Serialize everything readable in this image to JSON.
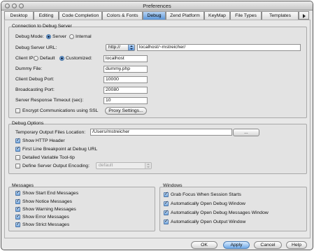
{
  "window": {
    "title": "Preferences"
  },
  "tabs": [
    "Desktop",
    "Editing",
    "Code Completion",
    "Colors & Fonts",
    "Debug",
    "Zend Platform",
    "KeyMap",
    "File Types",
    "Templates"
  ],
  "active_tab": "Debug",
  "connection": {
    "title": "Connection to Debug Server",
    "debug_mode_label": "Debug Mode:",
    "mode_server": "Server",
    "mode_internal": "Internal",
    "server_url_label": "Debug Server URL:",
    "protocol": "http://",
    "server_url": "localhost/~mstreicher/",
    "client_ip_label": "Client IP:",
    "ip_default": "Default",
    "ip_customized": "Customized:",
    "client_ip_value": "localhost",
    "dummy_file_label": "Dummy File:",
    "dummy_file_value": "dummy.php",
    "client_port_label": "Client Debug Port:",
    "client_port_value": "10000",
    "broadcast_port_label": "Broadcasting Port:",
    "broadcast_port_value": "20080",
    "timeout_label": "Server Response Timeout (sec):",
    "timeout_value": "10",
    "encrypt_label": "Encrypt Communications using SSL",
    "proxy_button": "Proxy Settings..."
  },
  "options": {
    "title": "Debug Options",
    "temp_dir_label": "Temporary Output Files Location:",
    "temp_dir_value": "/Users/mstreicher",
    "browse_button": "...",
    "show_http_header": "Show HTTP Header",
    "first_line_bp": "First Line Breakpoint at Debug URL",
    "detailed_tooltip": "Detailed Variable Tool-tip",
    "define_encoding": "Define Server Output Encoding:",
    "encoding_value": "default"
  },
  "messages": {
    "title": "Messages",
    "items": [
      "Show Start End Messages",
      "Show Notice Messages",
      "Show Warning Messages",
      "Show Error Messages",
      "Show Strict Messages"
    ]
  },
  "windows": {
    "title": "Windows",
    "items": [
      "Grab Focus When Session Starts",
      "Automatically Open Debug Window",
      "Automatically Open Debug Messages Window",
      "Automatically Open Output Window"
    ]
  },
  "footer": {
    "ok": "OK",
    "apply": "Apply",
    "cancel": "Cancel",
    "help": "Help"
  },
  "colors": {
    "accent": "#5c95d8",
    "window_bg": "#e8e8e8"
  }
}
